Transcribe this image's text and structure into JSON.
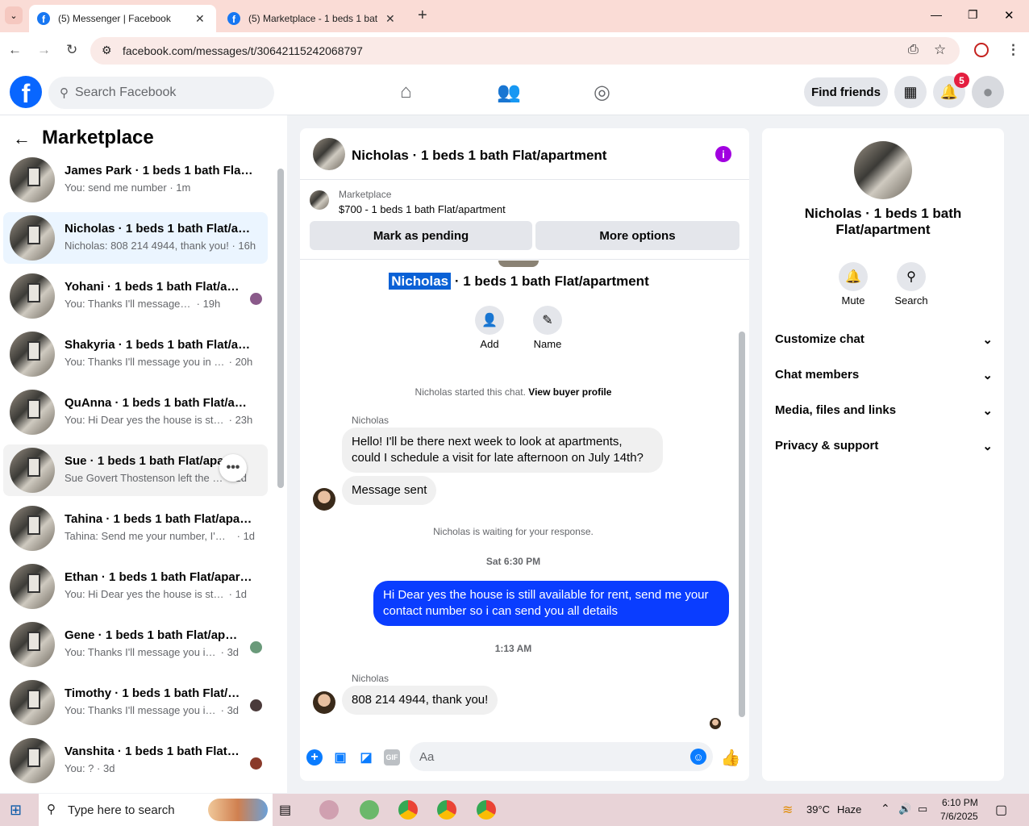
{
  "browser": {
    "tabs": [
      {
        "title": "(5) Messenger | Facebook",
        "close": "✕"
      },
      {
        "title": "(5) Marketplace - 1 beds 1 bath",
        "close": "✕"
      }
    ],
    "new_tab": "+",
    "url": "facebook.com/messages/t/30642115242068797",
    "window_controls": [
      "—",
      "❐",
      "✕"
    ]
  },
  "header": {
    "logo": "f",
    "search_placeholder": "Search Facebook",
    "find_friends": "Find friends",
    "notification_count": "5"
  },
  "sidebar": {
    "title": "Marketplace",
    "conversations": [
      {
        "name": "James Park · 1 beds 1 bath Flat/a...",
        "preview": "You: send me number",
        "time": "· 1m"
      },
      {
        "name": "Nicholas · 1 beds 1 bath Flat/apa...",
        "preview": "Nicholas: 808 214 4944, thank you!",
        "time": "· 16h"
      },
      {
        "name": "Yohani · 1 beds 1 bath Flat/apa...",
        "preview": "You: Thanks I'll message you in...",
        "time": "· 19h"
      },
      {
        "name": "Shakyria · 1 beds 1 bath Flat/apa...",
        "preview": "You: Thanks I'll message you in a ...",
        "time": "· 20h"
      },
      {
        "name": "QuAnna · 1 beds 1 bath Flat/apar...",
        "preview": "You: Hi Dear yes the house is still ...",
        "time": "· 23h"
      },
      {
        "name": "Sue · 1 beds 1 bath Flat/apartment",
        "preview": "Sue Govert Thostenson left the gr...",
        "time": "· 1d"
      },
      {
        "name": "Tahina · 1 beds 1 bath Flat/apart...",
        "preview": "Tahina: Send me your number, I'm i...",
        "time": "· 1d"
      },
      {
        "name": "Ethan · 1 beds 1 bath Flat/apart...",
        "preview": "You: Hi Dear yes the house is still a...",
        "time": "· 1d"
      },
      {
        "name": "Gene · 1 beds 1 bath Flat/apar...",
        "preview": "You: Thanks I'll message you in ...",
        "time": "· 3d"
      },
      {
        "name": "Timothy · 1 beds 1 bath Flat/a...",
        "preview": "You: Thanks I'll message you in ...",
        "time": "· 3d"
      },
      {
        "name": "Vanshita · 1 beds 1 bath Flat/a...",
        "preview": "You: ?",
        "time": "· 3d"
      }
    ]
  },
  "chat": {
    "title": "Nicholas · 1 beds 1 bath Flat/apartment",
    "marketplace_label": "Marketplace",
    "listing": "$700 - 1 beds 1 bath Flat/apartment",
    "mark_pending": "Mark as pending",
    "more_options": "More options",
    "intro_name_highlight": "Nicholas",
    "intro_name_rest": " · 1 beds 1 bath Flat/apartment",
    "add_label": "Add",
    "name_label": "Name",
    "started_text": "Nicholas started this chat.",
    "view_profile": "View buyer profile",
    "sender": "Nicholas",
    "msg1": "Hello! I'll be there next week to look at apartments, could I schedule a visit for late afternoon on July 14th?",
    "msg2": "Message sent",
    "waiting": "Nicholas is waiting for your response.",
    "time1": "Sat 6:30 PM",
    "msg3": "Hi Dear yes the house is still available for rent, send me your contact number so i can send you all details",
    "time2": "1:13 AM",
    "msg4": "808 214 4944, thank you!",
    "composer_placeholder": "Aa"
  },
  "right_panel": {
    "name": "Nicholas · 1 beds 1 bath Flat/apartment",
    "mute": "Mute",
    "search": "Search",
    "sections": [
      "Customize chat",
      "Chat members",
      "Media, files and links",
      "Privacy & support"
    ]
  },
  "taskbar": {
    "search_placeholder": "Type here to search",
    "temperature": "39°C",
    "weather": "Haze",
    "time": "6:10 PM",
    "date": "7/6/2025"
  }
}
